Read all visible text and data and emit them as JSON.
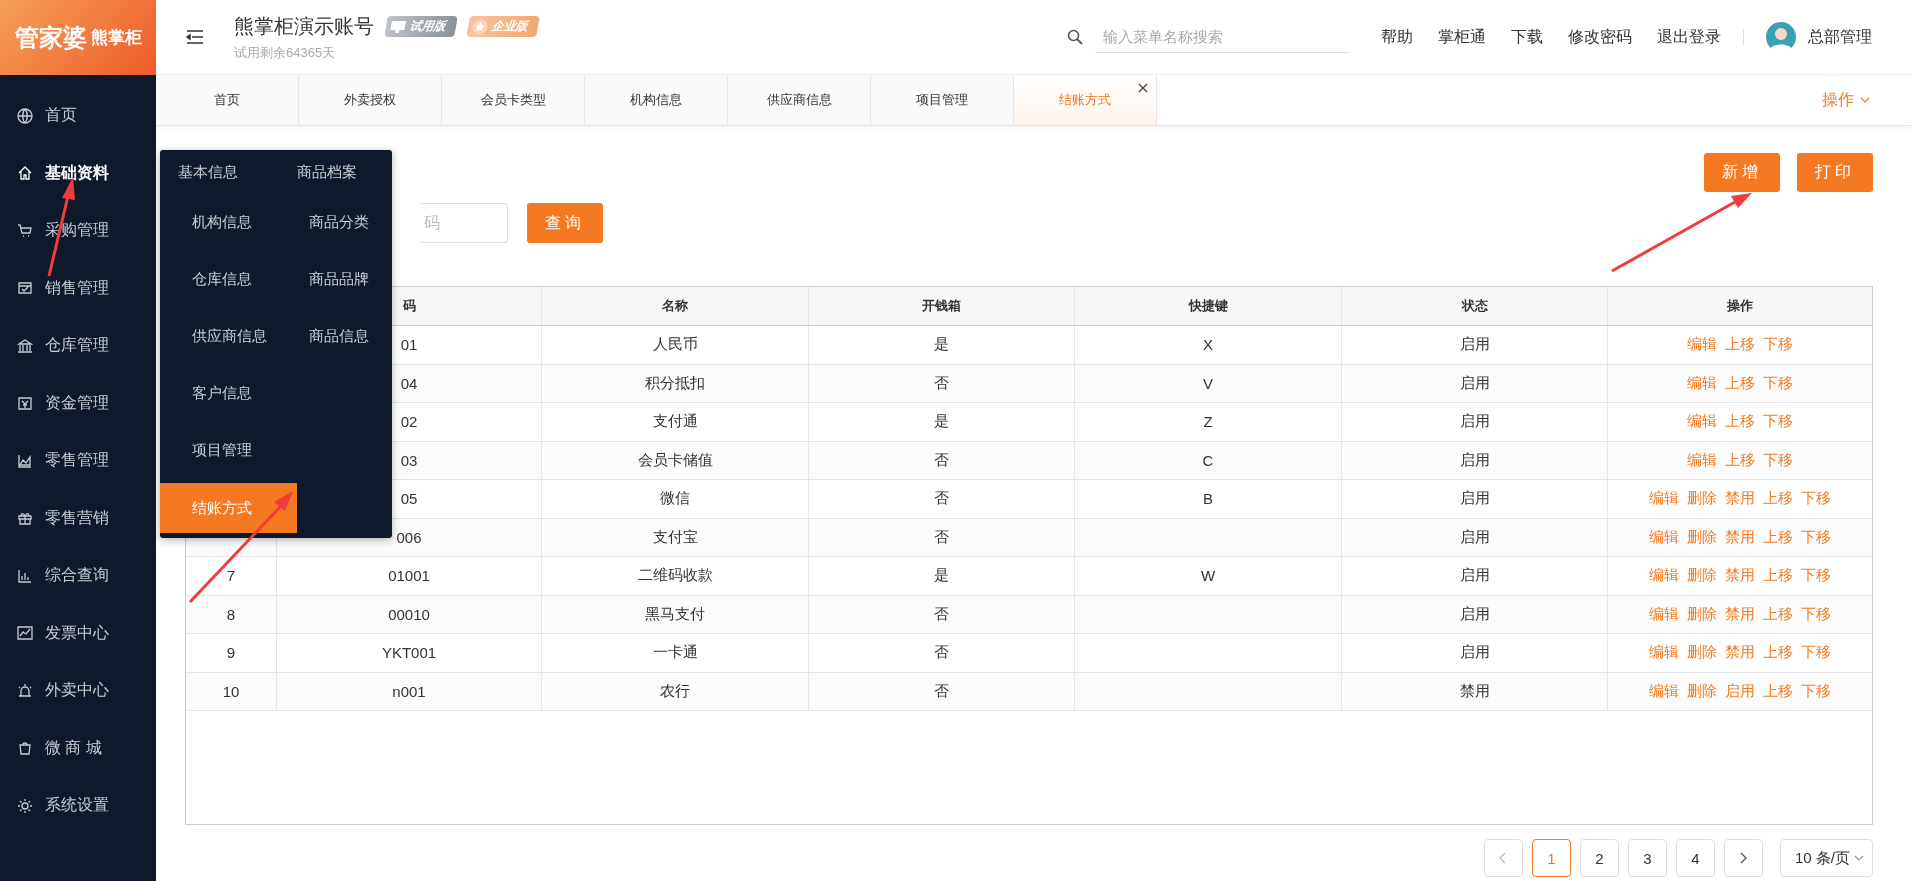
{
  "sidebar": {
    "logo": {
      "brand": "管家婆",
      "product": "熊掌柜"
    },
    "items": [
      {
        "label": "首页",
        "selected": false
      },
      {
        "label": "基础资料",
        "selected": true
      },
      {
        "label": "采购管理",
        "selected": false
      },
      {
        "label": "销售管理",
        "selected": false
      },
      {
        "label": "仓库管理",
        "selected": false
      },
      {
        "label": "资金管理",
        "selected": false
      },
      {
        "label": "零售管理",
        "selected": false
      },
      {
        "label": "零售营销",
        "selected": false
      },
      {
        "label": "综合查询",
        "selected": false
      },
      {
        "label": "发票中心",
        "selected": false
      },
      {
        "label": "外卖中心",
        "selected": false
      },
      {
        "label": "微 商 城",
        "selected": false
      },
      {
        "label": "系统设置",
        "selected": false
      }
    ]
  },
  "header": {
    "title": "熊掌柜演示账号",
    "badges": [
      "试用版",
      "企业版"
    ],
    "trial_note": "试用剩余64365天",
    "search": {
      "placeholder": "输入菜单名称搜索"
    },
    "links": [
      "帮助",
      "掌柜通",
      "下载",
      "修改密码",
      "退出登录"
    ],
    "user": "总部管理"
  },
  "tabs": [
    {
      "label": "首页",
      "selected": false
    },
    {
      "label": "外卖授权",
      "selected": false
    },
    {
      "label": "会员卡类型",
      "selected": false
    },
    {
      "label": "机构信息",
      "selected": false
    },
    {
      "label": "供应商信息",
      "selected": false
    },
    {
      "label": "项目管理",
      "selected": false
    },
    {
      "label": "结账方式",
      "selected": true
    }
  ],
  "tab_menu": "操作",
  "flyout": {
    "columns": [
      {
        "heading": "基本信息",
        "items": [
          {
            "label": "机构信息",
            "selected": false
          },
          {
            "label": "仓库信息",
            "selected": false
          },
          {
            "label": "供应商信息",
            "selected": false
          },
          {
            "label": "客户信息",
            "selected": false
          },
          {
            "label": "项目管理",
            "selected": false
          },
          {
            "label": "结账方式",
            "selected": true
          }
        ]
      },
      {
        "heading": "商品档案",
        "items": [
          {
            "label": "商品分类",
            "selected": false
          },
          {
            "label": "商品品牌",
            "selected": false
          },
          {
            "label": "商品信息",
            "selected": false
          }
        ]
      }
    ]
  },
  "toolbar": {
    "add_button": "新增",
    "print_button": "打印",
    "search": {
      "placeholder": "码"
    },
    "query_button": "查询"
  },
  "table": {
    "columns": [
      "码",
      "名称",
      "开钱箱",
      "快捷键",
      "状态",
      "操作"
    ],
    "rows": [
      {
        "code": "01",
        "name": "人民币",
        "cash_drawer": "是",
        "hotkey": "X",
        "status": "启用",
        "actions": [
          "编辑",
          "上移",
          "下移"
        ]
      },
      {
        "code": "04",
        "name": "积分抵扣",
        "cash_drawer": "否",
        "hotkey": "V",
        "status": "启用",
        "actions": [
          "编辑",
          "上移",
          "下移"
        ]
      },
      {
        "code": "02",
        "name": "支付通",
        "cash_drawer": "是",
        "hotkey": "Z",
        "status": "启用",
        "actions": [
          "编辑",
          "上移",
          "下移"
        ]
      },
      {
        "code": "03",
        "name": "会员卡储值",
        "cash_drawer": "否",
        "hotkey": "C",
        "status": "启用",
        "actions": [
          "编辑",
          "上移",
          "下移"
        ]
      },
      {
        "code": "05",
        "name": "微信",
        "cash_drawer": "否",
        "hotkey": "B",
        "status": "启用",
        "actions": [
          "编辑",
          "删除",
          "禁用",
          "上移",
          "下移"
        ]
      },
      {
        "code": "006",
        "name": "支付宝",
        "cash_drawer": "否",
        "status": "启用",
        "actions": [
          "编辑",
          "删除",
          "禁用",
          "上移",
          "下移"
        ]
      },
      {
        "number": "7",
        "code": "01001",
        "name": "二维码收款",
        "cash_drawer": "是",
        "hotkey": "W",
        "status": "启用",
        "actions": [
          "编辑",
          "删除",
          "禁用",
          "上移",
          "下移"
        ]
      },
      {
        "number": "8",
        "code": "00010",
        "name": "黑马支付",
        "cash_drawer": "否",
        "status": "启用",
        "actions": [
          "编辑",
          "删除",
          "禁用",
          "上移",
          "下移"
        ]
      },
      {
        "number": "9",
        "code": "YKT001",
        "name": "一卡通",
        "cash_drawer": "否",
        "status": "启用",
        "actions": [
          "编辑",
          "删除",
          "禁用",
          "上移",
          "下移"
        ]
      },
      {
        "number": "10",
        "code": "n001",
        "name": "农行",
        "cash_drawer": "否",
        "status": "禁用",
        "actions": [
          "编辑",
          "删除",
          "启用",
          "上移",
          "下移"
        ]
      }
    ]
  },
  "pagination": {
    "pages": [
      {
        "label": "1",
        "selected": true
      },
      {
        "label": "2",
        "selected": false
      },
      {
        "label": "3",
        "selected": false
      },
      {
        "label": "4",
        "selected": false
      }
    ],
    "page_size": "10 条/页"
  }
}
